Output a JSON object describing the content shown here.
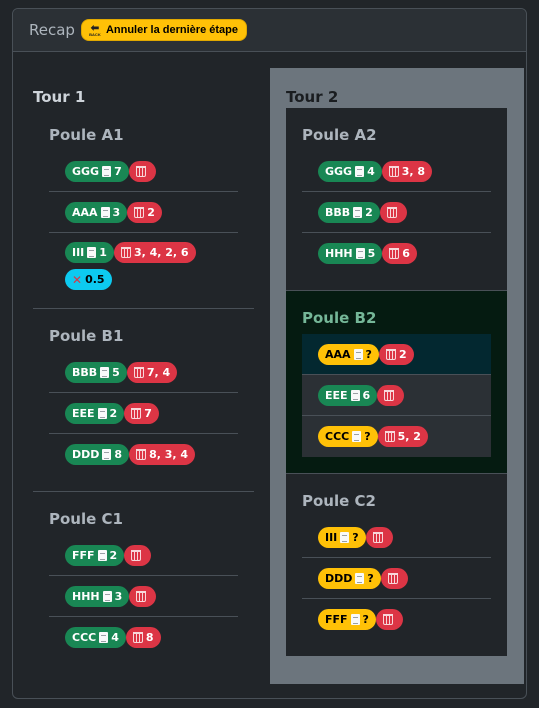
{
  "header": {
    "title": "Recap",
    "undo_label": "Annuler la dernière étape",
    "undo_icon_text": "BACK"
  },
  "tour1": {
    "title": "Tour 1",
    "poules": [
      {
        "title": "Poule A1",
        "teams": [
          {
            "name": "GGG",
            "score": "7",
            "trash": ""
          },
          {
            "name": "AAA",
            "score": "3",
            "trash": "2"
          },
          {
            "name": "III",
            "score": "1",
            "trash": "3, 4, 2, 6",
            "penalty": "0.5"
          }
        ]
      },
      {
        "title": "Poule B1",
        "teams": [
          {
            "name": "BBB",
            "score": "5",
            "trash": "7, 4"
          },
          {
            "name": "EEE",
            "score": "2",
            "trash": "7"
          },
          {
            "name": "DDD",
            "score": "8",
            "trash": "8, 3, 4"
          }
        ]
      },
      {
        "title": "Poule C1",
        "teams": [
          {
            "name": "FFF",
            "score": "2",
            "trash": ""
          },
          {
            "name": "HHH",
            "score": "3",
            "trash": ""
          },
          {
            "name": "CCC",
            "score": "4",
            "trash": "8"
          }
        ]
      }
    ]
  },
  "tour2": {
    "title": "Tour 2",
    "poules": [
      {
        "title": "Poule A2",
        "teams": [
          {
            "name": "GGG",
            "score": "4",
            "trash": "3, 8"
          },
          {
            "name": "BBB",
            "score": "2",
            "trash": ""
          },
          {
            "name": "HHH",
            "score": "5",
            "trash": "6"
          }
        ]
      },
      {
        "title": "Poule B2",
        "teams": [
          {
            "name": "AAA",
            "score": "?",
            "trash": "2"
          },
          {
            "name": "EEE",
            "score": "6",
            "trash": ""
          },
          {
            "name": "CCC",
            "score": "?",
            "trash": "5, 2"
          }
        ]
      },
      {
        "title": "Poule C2",
        "teams": [
          {
            "name": "III",
            "score": "?",
            "trash": ""
          },
          {
            "name": "DDD",
            "score": "?",
            "trash": ""
          },
          {
            "name": "FFF",
            "score": "?",
            "trash": ""
          }
        ]
      }
    ]
  },
  "colors": {
    "done": "#198754",
    "pending": "#ffc107",
    "trash": "#dc3545",
    "penalty": "#0dcaf0",
    "active_poule": "#051b11"
  },
  "icons": {
    "score": "sheet-icon",
    "trash": "trash-bin-icon",
    "penalty": "cross-icon",
    "undo": "back-arrow-icon"
  }
}
